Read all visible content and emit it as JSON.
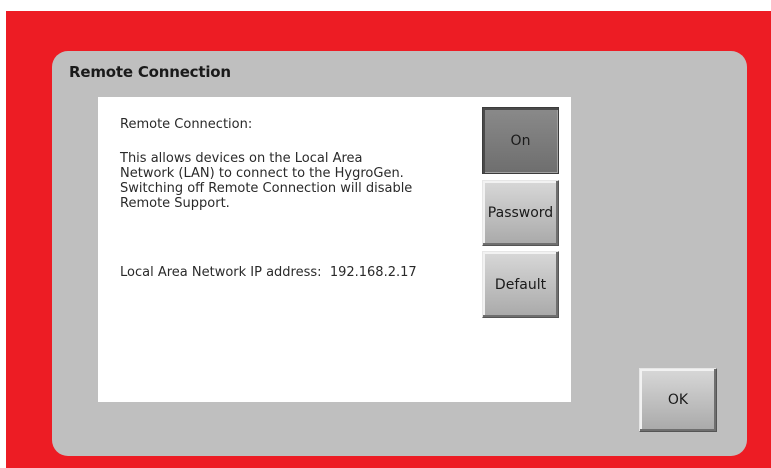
{
  "dialog": {
    "title": "Remote Connection"
  },
  "panel": {
    "heading": "Remote Connection:",
    "description": "This allows devices on the Local Area\nNetwork (LAN) to connect to the HygroGen.\nSwitching off Remote Connection will disable\nRemote Support.",
    "ip_label": "Local Area Network IP address:",
    "ip_value": "192.168.2.17"
  },
  "buttons": {
    "on": "On",
    "password": "Password",
    "default": "Default",
    "ok": "OK"
  },
  "colors": {
    "frame": "#ed1c24",
    "dialog_bg": "#bfbfbf",
    "panel_bg": "#ffffff",
    "button_pressed": "#7a7a7a"
  },
  "state": {
    "remote_connection_on": true
  }
}
